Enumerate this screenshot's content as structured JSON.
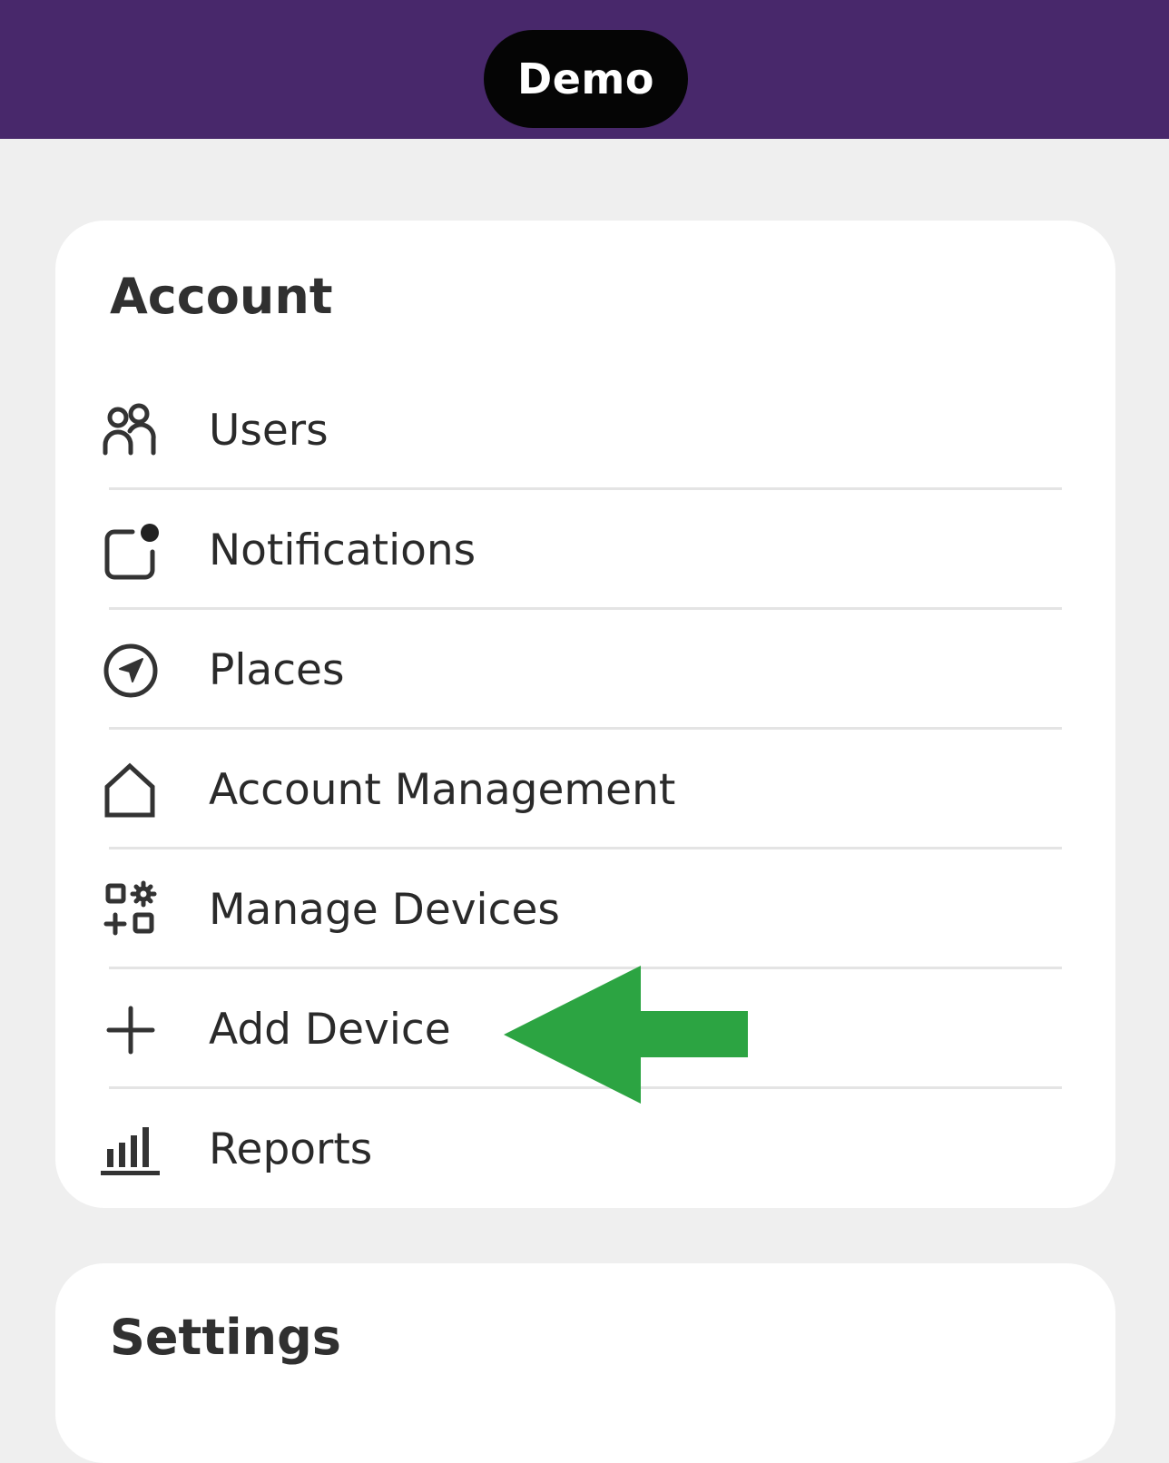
{
  "header": {
    "pill_label": "Demo",
    "background_color": "#48286b"
  },
  "account": {
    "title": "Account",
    "items": [
      {
        "label": "Users",
        "icon": "users-icon"
      },
      {
        "label": "Notifications",
        "icon": "notification-badge-icon"
      },
      {
        "label": "Places",
        "icon": "navigation-compass-icon"
      },
      {
        "label": "Account Management",
        "icon": "home-icon"
      },
      {
        "label": "Manage Devices",
        "icon": "device-grid-gear-icon"
      },
      {
        "label": "Add Device",
        "icon": "plus-icon"
      },
      {
        "label": "Reports",
        "icon": "bar-chart-icon"
      }
    ]
  },
  "settings": {
    "title": "Settings"
  },
  "annotation": {
    "arrow_color": "#2ca442",
    "points_to": "Add Device"
  }
}
